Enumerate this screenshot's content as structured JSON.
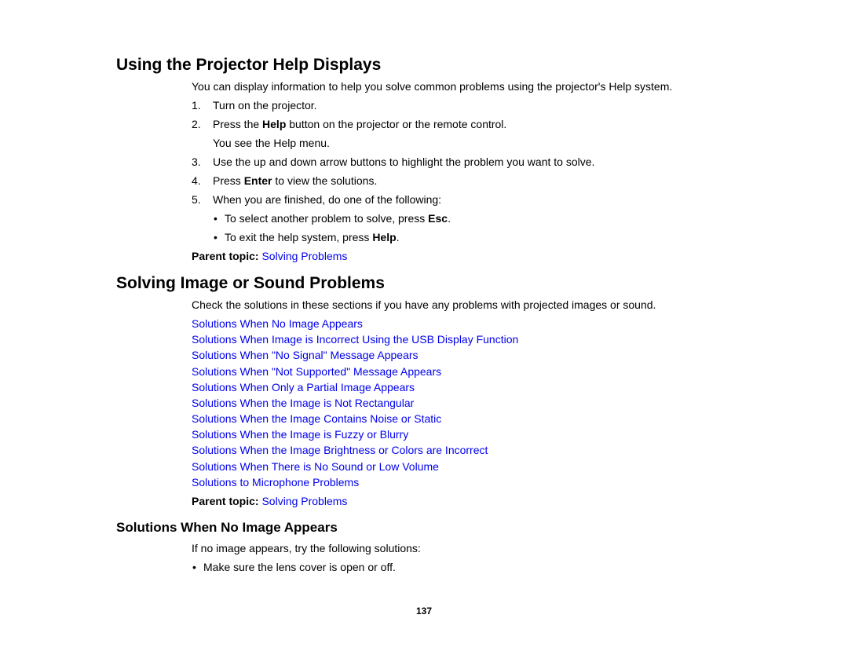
{
  "section1": {
    "title": "Using the Projector Help Displays",
    "intro": "You can display information to help you solve common problems using the projector's Help system.",
    "steps": [
      {
        "num": "1.",
        "text": "Turn on the projector."
      },
      {
        "num": "2.",
        "pre": "Press the ",
        "bold": "Help",
        "post": " button on the projector or the remote control.",
        "note": "You see the Help menu."
      },
      {
        "num": "3.",
        "text": "Use the up and down arrow buttons to highlight the problem you want to solve."
      },
      {
        "num": "4.",
        "pre": "Press ",
        "bold": "Enter",
        "post": " to view the solutions."
      },
      {
        "num": "5.",
        "text": "When you are finished, do one of the following:"
      }
    ],
    "sub_bullets": [
      {
        "pre": "To select another problem to solve, press ",
        "bold": "Esc",
        "post": "."
      },
      {
        "pre": "To exit the help system, press ",
        "bold": "Help",
        "post": "."
      }
    ],
    "parent_label": "Parent topic:",
    "parent_link": "Solving Problems"
  },
  "section2": {
    "title": "Solving Image or Sound Problems",
    "intro": "Check the solutions in these sections if you have any problems with projected images or sound.",
    "links": [
      "Solutions When No Image Appears",
      "Solutions When Image is Incorrect Using the USB Display Function",
      "Solutions When \"No Signal\" Message Appears",
      "Solutions When \"Not Supported\" Message Appears",
      "Solutions When Only a Partial Image Appears",
      "Solutions When the Image is Not Rectangular",
      "Solutions When the Image Contains Noise or Static",
      "Solutions When the Image is Fuzzy or Blurry",
      "Solutions When the Image Brightness or Colors are Incorrect",
      "Solutions When There is No Sound or Low Volume",
      "Solutions to Microphone Problems"
    ],
    "parent_label": "Parent topic:",
    "parent_link": "Solving Problems"
  },
  "section3": {
    "title": "Solutions When No Image Appears",
    "intro": "If no image appears, try the following solutions:",
    "bullets": [
      "Make sure the lens cover is open or off."
    ]
  },
  "bullet_glyph": "•",
  "page_number": "137",
  "colors": {
    "link": "#0000ee",
    "text": "#000000"
  }
}
